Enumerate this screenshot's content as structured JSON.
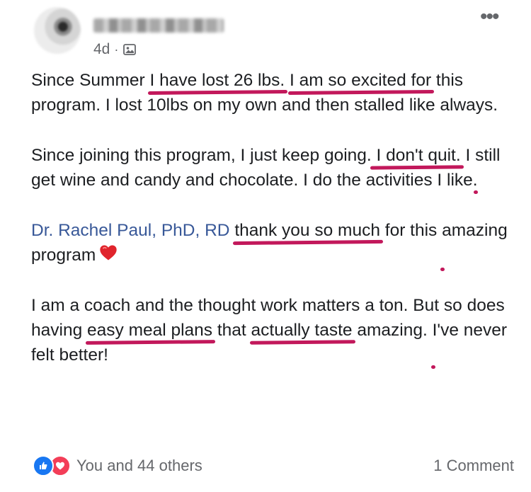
{
  "post": {
    "author": {
      "timestamp": "4d",
      "separator": "·",
      "audience_icon": "audience-icon"
    },
    "more_icon": "more-icon",
    "paragraphs": {
      "p1": {
        "t1": "Since Summer ",
        "u1": "I have lost 26 lbs.",
        "t2": " ",
        "u2": "I am so excited for",
        "t3": " this program. I lost 10lbs on my own and then stalled like always."
      },
      "p2": {
        "t1": "Since joining this program, I just keep going.",
        "u1": " I don't quit.",
        "t2": " I ",
        "u2": "still get wine and candy and chocolate",
        "t3": ". I do the activities I like."
      },
      "p3": {
        "mention": "Dr. Rachel Paul, PhD, RD",
        "t1": " ",
        "u1": "thank you so much",
        "t2": " for this ",
        "u2": "amazing program",
        "emoji": "heart-icon"
      },
      "p4": {
        "t1": "I am a coach and the thought work matters a ton. But so does having ",
        "u1": "easy meal plans",
        "t2": " that ",
        "u2": "actually taste",
        "t3": " amazing. ",
        "u3": "I've never felt better!"
      }
    },
    "footer": {
      "reactions_text": "You and 44 others",
      "comments_text": "1 Comment"
    },
    "colors": {
      "underline": "#c2185b",
      "mention": "#385898",
      "like": "#1877f2",
      "love": "#f33e58"
    }
  }
}
